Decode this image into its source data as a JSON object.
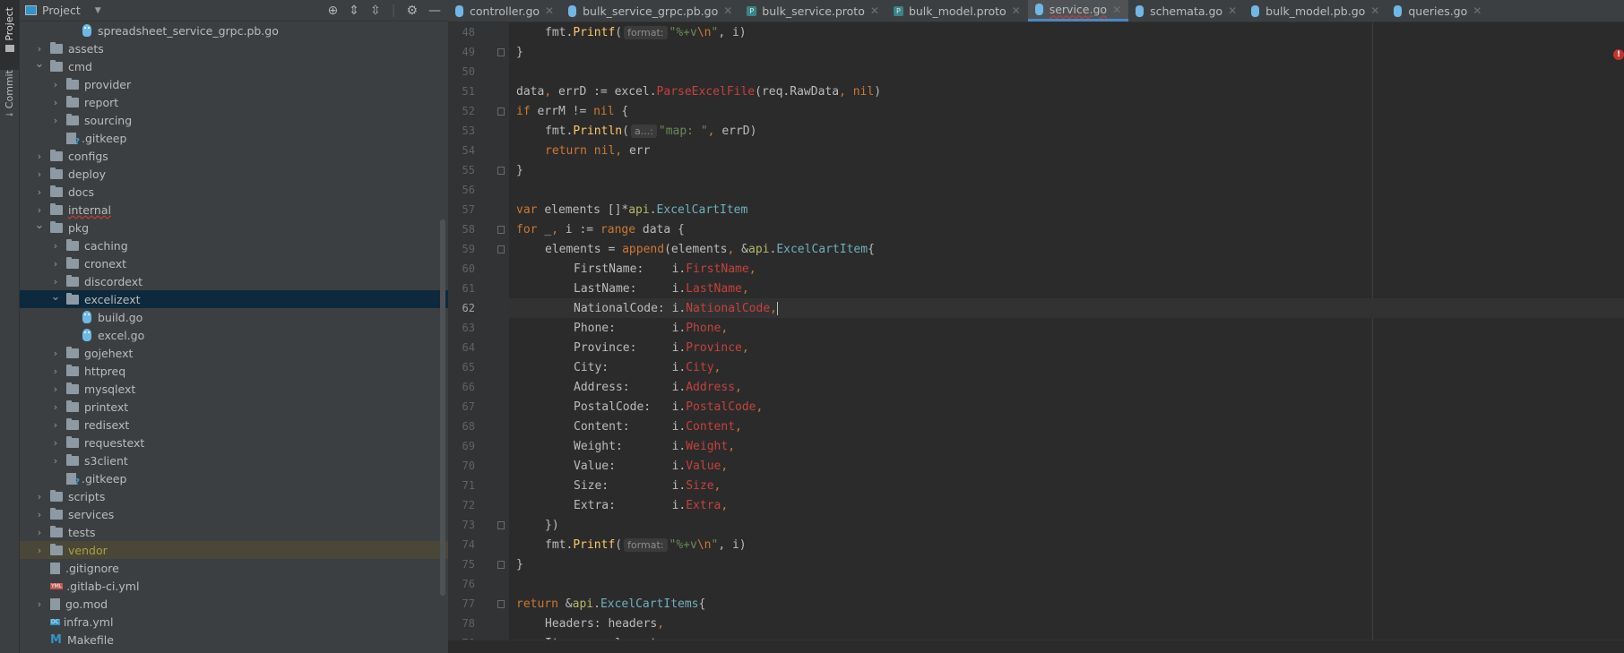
{
  "left_strip": {
    "tabs": [
      {
        "label": "Project",
        "active": true
      },
      {
        "label": "Commit",
        "active": false
      }
    ]
  },
  "project_panel": {
    "title": "Project",
    "tools": [
      "locate-icon",
      "expand-all-icon",
      "collapse-all-icon",
      "gear-icon",
      "hide-icon"
    ],
    "tree": [
      {
        "label": "spreadsheet_service_grpc.pb.go",
        "depth": 3,
        "kind": "go",
        "expandable": false
      },
      {
        "label": "assets",
        "depth": 1,
        "kind": "folder",
        "expandable": true,
        "expanded": false
      },
      {
        "label": "cmd",
        "depth": 1,
        "kind": "folder",
        "expandable": true,
        "expanded": true
      },
      {
        "label": "provider",
        "depth": 2,
        "kind": "folder",
        "expandable": true,
        "expanded": false
      },
      {
        "label": "report",
        "depth": 2,
        "kind": "folder",
        "expandable": true,
        "expanded": false
      },
      {
        "label": "sourcing",
        "depth": 2,
        "kind": "folder",
        "expandable": true,
        "expanded": false
      },
      {
        "label": ".gitkeep",
        "depth": 2,
        "kind": "unknown",
        "expandable": false
      },
      {
        "label": "configs",
        "depth": 1,
        "kind": "folder",
        "expandable": true,
        "expanded": false
      },
      {
        "label": "deploy",
        "depth": 1,
        "kind": "folder",
        "expandable": true,
        "expanded": false
      },
      {
        "label": "docs",
        "depth": 1,
        "kind": "folder",
        "expandable": true,
        "expanded": false
      },
      {
        "label": "internal",
        "depth": 1,
        "kind": "folder",
        "expandable": true,
        "expanded": false,
        "error": true
      },
      {
        "label": "pkg",
        "depth": 1,
        "kind": "folder",
        "expandable": true,
        "expanded": true
      },
      {
        "label": "caching",
        "depth": 2,
        "kind": "folder",
        "expandable": true,
        "expanded": false
      },
      {
        "label": "cronext",
        "depth": 2,
        "kind": "folder",
        "expandable": true,
        "expanded": false
      },
      {
        "label": "discordext",
        "depth": 2,
        "kind": "folder",
        "expandable": true,
        "expanded": false
      },
      {
        "label": "excelizext",
        "depth": 2,
        "kind": "folder",
        "expandable": true,
        "expanded": true,
        "selected": true
      },
      {
        "label": "build.go",
        "depth": 3,
        "kind": "go",
        "expandable": false
      },
      {
        "label": "excel.go",
        "depth": 3,
        "kind": "go",
        "expandable": false
      },
      {
        "label": "gojehext",
        "depth": 2,
        "kind": "folder",
        "expandable": true,
        "expanded": false
      },
      {
        "label": "httpreq",
        "depth": 2,
        "kind": "folder",
        "expandable": true,
        "expanded": false
      },
      {
        "label": "mysqlext",
        "depth": 2,
        "kind": "folder",
        "expandable": true,
        "expanded": false
      },
      {
        "label": "printext",
        "depth": 2,
        "kind": "folder",
        "expandable": true,
        "expanded": false
      },
      {
        "label": "redisext",
        "depth": 2,
        "kind": "folder",
        "expandable": true,
        "expanded": false
      },
      {
        "label": "requestext",
        "depth": 2,
        "kind": "folder",
        "expandable": true,
        "expanded": false
      },
      {
        "label": "s3client",
        "depth": 2,
        "kind": "folder",
        "expandable": true,
        "expanded": false
      },
      {
        "label": ".gitkeep",
        "depth": 2,
        "kind": "unknown",
        "expandable": false
      },
      {
        "label": "scripts",
        "depth": 1,
        "kind": "folder",
        "expandable": true,
        "expanded": false
      },
      {
        "label": "services",
        "depth": 1,
        "kind": "folder",
        "expandable": true,
        "expanded": false
      },
      {
        "label": "tests",
        "depth": 1,
        "kind": "folder",
        "expandable": true,
        "expanded": false
      },
      {
        "label": "vendor",
        "depth": 1,
        "kind": "vendor",
        "expandable": true,
        "expanded": false
      },
      {
        "label": ".gitignore",
        "depth": 1,
        "kind": "ignore",
        "expandable": false
      },
      {
        "label": ".gitlab-ci.yml",
        "depth": 1,
        "kind": "yml",
        "expandable": false
      },
      {
        "label": "go.mod",
        "depth": 1,
        "kind": "mod",
        "expandable": true,
        "expanded": false
      },
      {
        "label": "infra.yml",
        "depth": 1,
        "kind": "dc",
        "expandable": false
      },
      {
        "label": "Makefile",
        "depth": 1,
        "kind": "make",
        "expandable": false
      }
    ]
  },
  "editor": {
    "tabs": [
      {
        "label": "controller.go",
        "icon": "go",
        "active": false
      },
      {
        "label": "bulk_service_grpc.pb.go",
        "icon": "go",
        "active": false
      },
      {
        "label": "bulk_service.proto",
        "icon": "proto",
        "active": false
      },
      {
        "label": "bulk_model.proto",
        "icon": "proto",
        "active": false
      },
      {
        "label": "service.go",
        "icon": "go",
        "active": true
      },
      {
        "label": "schemata.go",
        "icon": "go",
        "active": false
      },
      {
        "label": "bulk_model.pb.go",
        "icon": "go",
        "active": false
      },
      {
        "label": "queries.go",
        "icon": "go",
        "active": false
      }
    ],
    "error_count": "2",
    "current_line": 62,
    "lines": [
      {
        "n": 48,
        "indent": 2,
        "tokens": [
          [
            "fmt.",
            ""
          ],
          [
            "Printf",
            "fn"
          ],
          [
            "(",
            ""
          ],
          [
            "format:",
            "hint"
          ],
          [
            "\"%+v",
            "str"
          ],
          [
            "\\n",
            "esc"
          ],
          [
            "\"",
            "str"
          ],
          [
            ", i)",
            ""
          ]
        ]
      },
      {
        "n": 49,
        "indent": 1,
        "fold": true,
        "tokens": [
          [
            "}",
            ""
          ]
        ]
      },
      {
        "n": 50,
        "indent": 0,
        "tokens": []
      },
      {
        "n": 51,
        "indent": 1,
        "tokens": [
          [
            "data",
            ""
          ],
          [
            ", ",
            "kw"
          ],
          [
            "errD := excel.",
            ""
          ],
          [
            "ParseExcelFile",
            "fld"
          ],
          [
            "(req.RawData",
            ""
          ],
          [
            ", ",
            "kw"
          ],
          [
            "nil",
            "kw"
          ],
          [
            ")",
            ""
          ]
        ]
      },
      {
        "n": 52,
        "indent": 1,
        "fold": true,
        "tokens": [
          [
            "if ",
            "kw"
          ],
          [
            "errM != ",
            ""
          ],
          [
            "nil",
            "kw"
          ],
          [
            " {",
            ""
          ]
        ]
      },
      {
        "n": 53,
        "indent": 2,
        "tokens": [
          [
            "fmt.",
            ""
          ],
          [
            "Println",
            "fn"
          ],
          [
            "(",
            ""
          ],
          [
            "a...:",
            "hint"
          ],
          [
            "\"map: \"",
            "str"
          ],
          [
            ", ",
            "kw"
          ],
          [
            "errD)",
            ""
          ]
        ]
      },
      {
        "n": 54,
        "indent": 2,
        "tokens": [
          [
            "return ",
            "kw"
          ],
          [
            "nil",
            "kw"
          ],
          [
            ", ",
            "kw"
          ],
          [
            "err",
            ""
          ]
        ]
      },
      {
        "n": 55,
        "indent": 1,
        "fold": true,
        "tokens": [
          [
            "}",
            ""
          ]
        ]
      },
      {
        "n": 56,
        "indent": 0,
        "tokens": []
      },
      {
        "n": 57,
        "indent": 1,
        "tokens": [
          [
            "var ",
            "kw"
          ],
          [
            "elements []*",
            ""
          ],
          [
            "api",
            "pkg"
          ],
          [
            ".",
            ""
          ],
          [
            "ExcelCartItem",
            "type"
          ]
        ]
      },
      {
        "n": 58,
        "indent": 1,
        "fold": true,
        "tokens": [
          [
            "for ",
            "kw"
          ],
          [
            "_",
            ""
          ],
          [
            ", ",
            "kw"
          ],
          [
            "i := ",
            ""
          ],
          [
            "range ",
            "kw"
          ],
          [
            "data {",
            ""
          ]
        ]
      },
      {
        "n": 59,
        "indent": 2,
        "fold": true,
        "tokens": [
          [
            "elements = ",
            ""
          ],
          [
            "append",
            "kw"
          ],
          [
            "(elements",
            ""
          ],
          [
            ", ",
            "kw"
          ],
          [
            "&",
            ""
          ],
          [
            "api",
            "pkg"
          ],
          [
            ".",
            ""
          ],
          [
            "ExcelCartItem",
            "type"
          ],
          [
            "{",
            ""
          ]
        ]
      },
      {
        "n": 60,
        "indent": 3,
        "tokens": [
          [
            "FirstName:    i.",
            ""
          ],
          [
            "FirstName",
            "fld"
          ],
          [
            ",",
            "kw"
          ]
        ]
      },
      {
        "n": 61,
        "indent": 3,
        "tokens": [
          [
            "LastName:     i.",
            ""
          ],
          [
            "LastName",
            "fld"
          ],
          [
            ",",
            "kw"
          ]
        ]
      },
      {
        "n": 62,
        "indent": 3,
        "tokens": [
          [
            "NationalCode: i.",
            ""
          ],
          [
            "NationalCode",
            "fld"
          ],
          [
            ",",
            "kw"
          ],
          [
            "|",
            "caret"
          ]
        ]
      },
      {
        "n": 63,
        "indent": 3,
        "tokens": [
          [
            "Phone:        i.",
            ""
          ],
          [
            "Phone",
            "fld"
          ],
          [
            ",",
            "kw"
          ]
        ]
      },
      {
        "n": 64,
        "indent": 3,
        "tokens": [
          [
            "Province:     i.",
            ""
          ],
          [
            "Province",
            "fld"
          ],
          [
            ",",
            "kw"
          ]
        ]
      },
      {
        "n": 65,
        "indent": 3,
        "tokens": [
          [
            "City:         i.",
            ""
          ],
          [
            "City",
            "fld"
          ],
          [
            ",",
            "kw"
          ]
        ]
      },
      {
        "n": 66,
        "indent": 3,
        "tokens": [
          [
            "Address:      i.",
            ""
          ],
          [
            "Address",
            "fld"
          ],
          [
            ",",
            "kw"
          ]
        ]
      },
      {
        "n": 67,
        "indent": 3,
        "tokens": [
          [
            "PostalCode:   i.",
            ""
          ],
          [
            "PostalCode",
            "fld"
          ],
          [
            ",",
            "kw"
          ]
        ]
      },
      {
        "n": 68,
        "indent": 3,
        "tokens": [
          [
            "Content:      i.",
            ""
          ],
          [
            "Content",
            "fld"
          ],
          [
            ",",
            "kw"
          ]
        ]
      },
      {
        "n": 69,
        "indent": 3,
        "tokens": [
          [
            "Weight:       i.",
            ""
          ],
          [
            "Weight",
            "fld"
          ],
          [
            ",",
            "kw"
          ]
        ]
      },
      {
        "n": 70,
        "indent": 3,
        "tokens": [
          [
            "Value:        i.",
            ""
          ],
          [
            "Value",
            "fld"
          ],
          [
            ",",
            "kw"
          ]
        ]
      },
      {
        "n": 71,
        "indent": 3,
        "tokens": [
          [
            "Size:         i.",
            ""
          ],
          [
            "Size",
            "fld"
          ],
          [
            ",",
            "kw"
          ]
        ]
      },
      {
        "n": 72,
        "indent": 3,
        "tokens": [
          [
            "Extra:        i.",
            ""
          ],
          [
            "Extra",
            "fld"
          ],
          [
            ",",
            "kw"
          ]
        ]
      },
      {
        "n": 73,
        "indent": 2,
        "fold": true,
        "tokens": [
          [
            "})",
            ""
          ]
        ]
      },
      {
        "n": 74,
        "indent": 2,
        "tokens": [
          [
            "fmt.",
            ""
          ],
          [
            "Printf",
            "fn"
          ],
          [
            "(",
            ""
          ],
          [
            "format:",
            "hint"
          ],
          [
            "\"%+v",
            "str"
          ],
          [
            "\\n",
            "esc"
          ],
          [
            "\"",
            "str"
          ],
          [
            ", i)",
            ""
          ]
        ]
      },
      {
        "n": 75,
        "indent": 1,
        "fold": true,
        "tokens": [
          [
            "}",
            ""
          ]
        ]
      },
      {
        "n": 76,
        "indent": 0,
        "tokens": []
      },
      {
        "n": 77,
        "indent": 1,
        "fold": true,
        "tokens": [
          [
            "return ",
            "kw"
          ],
          [
            "&",
            ""
          ],
          [
            "api",
            "pkg"
          ],
          [
            ".",
            ""
          ],
          [
            "ExcelCartItems",
            "type"
          ],
          [
            "{",
            ""
          ]
        ]
      },
      {
        "n": 78,
        "indent": 2,
        "tokens": [
          [
            "Headers: headers",
            ""
          ],
          [
            ",",
            "kw"
          ]
        ]
      },
      {
        "n": 79,
        "indent": 2,
        "tokens": [
          [
            "Items:   elements",
            ""
          ]
        ]
      }
    ]
  }
}
